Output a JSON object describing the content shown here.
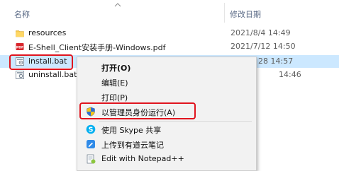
{
  "header": {
    "name_column": "名称",
    "date_column": "修改日期"
  },
  "files": [
    {
      "name": "resources",
      "date": "2021/8/4 14:49",
      "icon": "folder-icon"
    },
    {
      "name": "E-Shell_Client安装手册-Windows.pdf",
      "date": "2021/7/12 14:50",
      "icon": "pdf-icon"
    },
    {
      "name": "install.bat",
      "date": "28 14:57",
      "icon": "bat-file-icon"
    },
    {
      "name": "uninstall.bat",
      "date": "14:46",
      "icon": "bat-file-icon"
    }
  ],
  "context_menu": {
    "items": [
      {
        "label": "打开(O)",
        "bold": true
      },
      {
        "label": "编辑(E)"
      },
      {
        "label": "打印(P)"
      },
      {
        "label": "以管理员身份运行(A)",
        "icon": "uac-shield-icon"
      },
      {
        "label": "使用 Skype 共享",
        "icon": "skype-icon"
      },
      {
        "label": "上传到有道云笔记",
        "icon": "youdao-note-icon"
      },
      {
        "label": "Edit with Notepad++",
        "icon": "notepad-plus-plus-icon"
      }
    ]
  },
  "colors": {
    "highlight_red": "#e0141e",
    "selection_blue": "#cce8ff",
    "menu_background": "#f2f2f2"
  }
}
